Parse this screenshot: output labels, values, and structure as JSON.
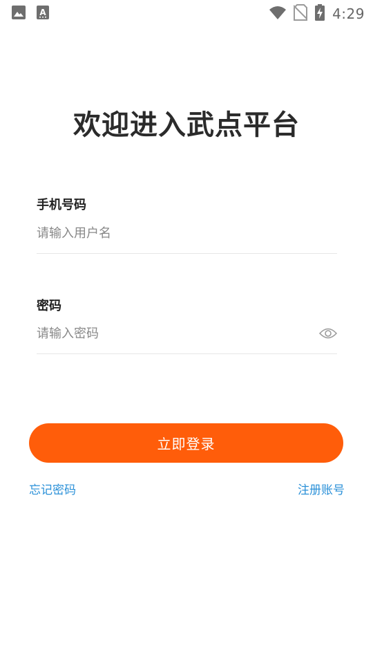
{
  "status_bar": {
    "time": "4:29",
    "left_icons": [
      "image-icon",
      "text-a-icon"
    ],
    "right_icons": [
      "wifi-icon",
      "no-sim-icon",
      "battery-charging-icon"
    ]
  },
  "title": "欢迎进入武点平台",
  "phone": {
    "label": "手机号码",
    "placeholder": "请输入用户名",
    "value": ""
  },
  "password": {
    "label": "密码",
    "placeholder": "请输入密码",
    "value": "",
    "toggle_icon": "eye-icon"
  },
  "login_button": {
    "label": "立即登录"
  },
  "links": {
    "forgot_password": "忘记密码",
    "register": "注册账号"
  },
  "colors": {
    "accent": "#ff5d0a",
    "link": "#2a90d8",
    "title": "#2b2b2b",
    "placeholder": "#888888",
    "divider": "#e6e6e6"
  }
}
